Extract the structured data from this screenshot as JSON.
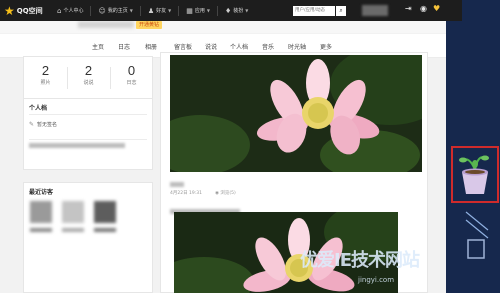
{
  "topbar": {
    "logo_text": "QQ空间",
    "nav": [
      {
        "label": "个人中心",
        "icon": "home-icon"
      },
      {
        "label": "我的主页",
        "icon": "user-icon",
        "dropdown": true
      },
      {
        "label": "好友",
        "icon": "friends-icon",
        "dropdown": true
      },
      {
        "label": "应用",
        "icon": "apps-icon",
        "dropdown": true
      },
      {
        "label": "装扮",
        "icon": "shirt-icon",
        "dropdown": true
      }
    ],
    "search_placeholder": "用户/应用/动态"
  },
  "header": {
    "badge": "开通黄钻"
  },
  "subnav": [
    "主页",
    "日志",
    "相册",
    "留言板",
    "说说",
    "个人档",
    "音乐",
    "时光轴",
    "更多"
  ],
  "stats": [
    {
      "num": "2",
      "label": "照片"
    },
    {
      "num": "2",
      "label": "说说"
    },
    {
      "num": "0",
      "label": "日志"
    }
  ],
  "profile": {
    "title": "个人档",
    "mood": "暂无签名"
  },
  "visitors": {
    "title": "最近访客"
  },
  "post": {
    "date": "4月22日 19:31",
    "views": "浏览(5)"
  },
  "watermark": {
    "main": "优爱ⅠE技术网站",
    "sub": "jingyi.com"
  },
  "colors": {
    "topbar": "#1d1d1d",
    "sidebar_bg": "#16284d",
    "highlight": "#d02b2b",
    "badge": "#ffd560"
  }
}
